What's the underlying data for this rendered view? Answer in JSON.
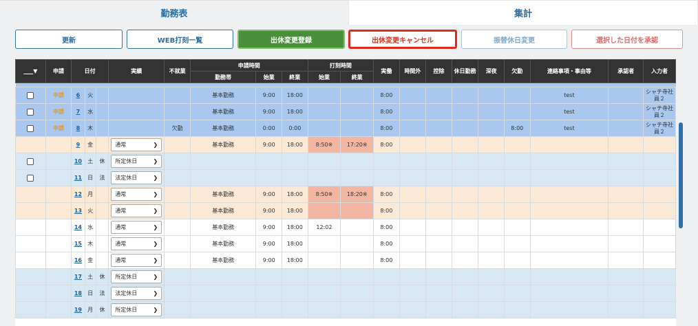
{
  "tabs": {
    "kintai": "勤務表",
    "shukei": "集計"
  },
  "buttons": {
    "update": "更新",
    "web_punch_list": "WEB打刻一覧",
    "register_change": "出休変更登録",
    "cancel_change": "出休変更キャンセル",
    "substitute_change": "振替休日変更",
    "approve_selected": "選択した日付を承認"
  },
  "header": {
    "select": "▼",
    "request": "申請",
    "date": "日付",
    "actual": "実績",
    "no_work": "不就業",
    "request_time": "申請時間",
    "shift": "勤務帯",
    "start": "始業",
    "end": "終業",
    "punch_time": "打刻時間",
    "punch_start": "始業",
    "punch_end": "終業",
    "worked": "実働",
    "overtime": "時間外",
    "deduction": "控除",
    "holiday_work": "休日勤務",
    "late_night": "深夜",
    "absence": "欠勤",
    "notes": "連絡事項・事由等",
    "approver": "承認者",
    "inputter": "入力者"
  },
  "rows": [
    {
      "checkbox": true,
      "request": "申請",
      "day": "6",
      "weekday": "火",
      "hol": "",
      "actual": "",
      "no_work": "",
      "shift": "基本勤務",
      "start": "9:00",
      "end": "18:00",
      "punch_start": "",
      "punch_end": "",
      "worked": "8:00",
      "absence": "",
      "notes": "test",
      "inputter": "シャチ寺社員２"
    },
    {
      "checkbox": true,
      "request": "申請",
      "day": "7",
      "weekday": "水",
      "hol": "",
      "actual": "",
      "no_work": "",
      "shift": "基本勤務",
      "start": "9:00",
      "end": "18:00",
      "punch_start": "",
      "punch_end": "",
      "worked": "8:00",
      "absence": "",
      "notes": "test",
      "inputter": "シャチ寺社員２"
    },
    {
      "checkbox": true,
      "request": "申請",
      "day": "8",
      "weekday": "木",
      "hol": "",
      "actual": "",
      "no_work": "欠勤",
      "shift": "基本勤務",
      "start": "0:00",
      "end": "0:00",
      "punch_start": "",
      "punch_end": "",
      "worked": "8:00",
      "absence": "8:00",
      "notes": "test",
      "inputter": "シャチ寺社員２"
    },
    {
      "checkbox": false,
      "request": "",
      "day": "9",
      "weekday": "金",
      "hol": "",
      "actual": "通常",
      "no_work": "",
      "shift": "基本勤務",
      "start": "9:00",
      "end": "18:00",
      "punch_start": "8:50※",
      "punch_end": "17:20※",
      "worked": "8:00",
      "absence": "",
      "notes": "",
      "inputter": ""
    },
    {
      "checkbox": true,
      "request": "",
      "day": "10",
      "weekday": "土",
      "hol": "休",
      "actual": "所定休日",
      "no_work": "",
      "shift": "",
      "start": "",
      "end": "",
      "punch_start": "",
      "punch_end": "",
      "worked": "",
      "absence": "",
      "notes": "",
      "inputter": ""
    },
    {
      "checkbox": true,
      "request": "",
      "day": "11",
      "weekday": "日",
      "hol": "法",
      "actual": "法定休日",
      "no_work": "",
      "shift": "",
      "start": "",
      "end": "",
      "punch_start": "",
      "punch_end": "",
      "worked": "",
      "absence": "",
      "notes": "",
      "inputter": ""
    },
    {
      "checkbox": false,
      "request": "",
      "day": "12",
      "weekday": "月",
      "hol": "",
      "actual": "通常",
      "no_work": "",
      "shift": "基本勤務",
      "start": "9:00",
      "end": "18:00",
      "punch_start": "8:50※",
      "punch_end": "18:20※",
      "worked": "8:00",
      "absence": "",
      "notes": "",
      "inputter": ""
    },
    {
      "checkbox": false,
      "request": "",
      "day": "13",
      "weekday": "火",
      "hol": "",
      "actual": "通常",
      "no_work": "",
      "shift": "基本勤務",
      "start": "9:00",
      "end": "18:00",
      "punch_start": "",
      "punch_end": "",
      "worked": "8:00",
      "absence": "",
      "notes": "",
      "inputter": ""
    },
    {
      "checkbox": false,
      "request": "",
      "day": "14",
      "weekday": "水",
      "hol": "",
      "actual": "通常",
      "no_work": "",
      "shift": "基本勤務",
      "start": "9:00",
      "end": "18:00",
      "punch_start": "12:02",
      "punch_end": "",
      "worked": "8:00",
      "absence": "",
      "notes": "",
      "inputter": ""
    },
    {
      "checkbox": false,
      "request": "",
      "day": "15",
      "weekday": "木",
      "hol": "",
      "actual": "通常",
      "no_work": "",
      "shift": "基本勤務",
      "start": "9:00",
      "end": "18:00",
      "punch_start": "",
      "punch_end": "",
      "worked": "8:00",
      "absence": "",
      "notes": "",
      "inputter": ""
    },
    {
      "checkbox": false,
      "request": "",
      "day": "16",
      "weekday": "金",
      "hol": "",
      "actual": "通常",
      "no_work": "",
      "shift": "基本勤務",
      "start": "9:00",
      "end": "18:00",
      "punch_start": "",
      "punch_end": "",
      "worked": "8:00",
      "absence": "",
      "notes": "",
      "inputter": ""
    },
    {
      "checkbox": false,
      "request": "",
      "day": "17",
      "weekday": "土",
      "hol": "休",
      "actual": "所定休日",
      "no_work": "",
      "shift": "",
      "start": "",
      "end": "",
      "punch_start": "",
      "punch_end": "",
      "worked": "",
      "absence": "",
      "notes": "",
      "inputter": ""
    },
    {
      "checkbox": false,
      "request": "",
      "day": "18",
      "weekday": "日",
      "hol": "法",
      "actual": "法定休日",
      "no_work": "",
      "shift": "",
      "start": "",
      "end": "",
      "punch_start": "",
      "punch_end": "",
      "worked": "",
      "absence": "",
      "notes": "",
      "inputter": ""
    },
    {
      "checkbox": false,
      "request": "",
      "day": "19",
      "weekday": "月",
      "hol": "休",
      "actual": "所定休日",
      "no_work": "",
      "shift": "",
      "start": "",
      "end": "",
      "punch_start": "",
      "punch_end": "",
      "worked": "",
      "absence": "",
      "notes": "",
      "inputter": ""
    }
  ]
}
